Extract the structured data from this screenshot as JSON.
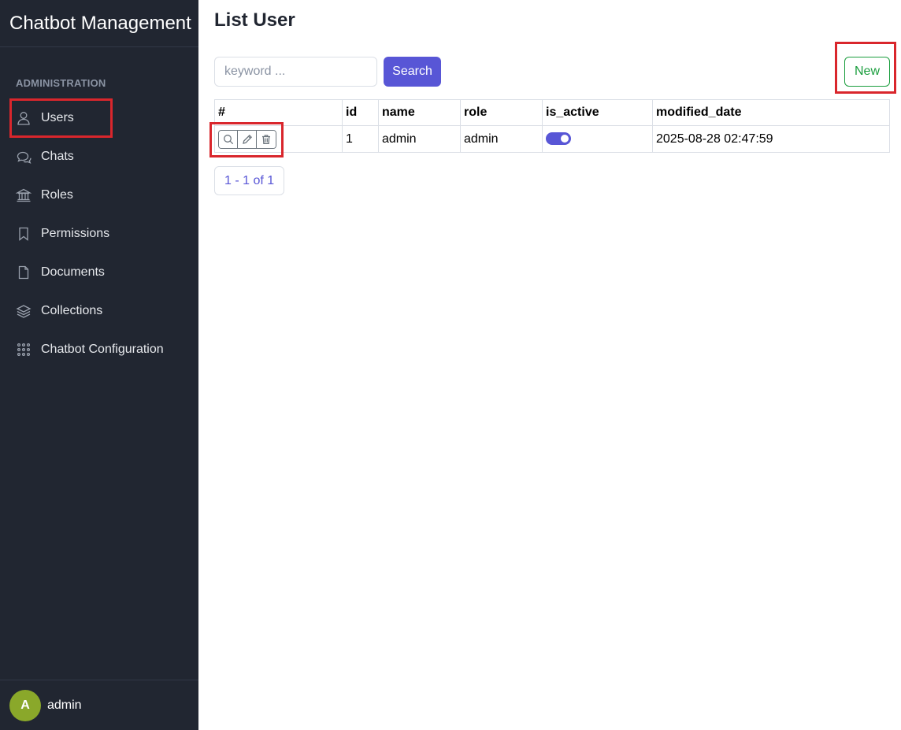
{
  "sidebar": {
    "brand": "Chatbot Management",
    "section_label": "ADMINISTRATION",
    "items": [
      {
        "label": "Users",
        "icon": "user-icon"
      },
      {
        "label": "Chats",
        "icon": "chat-icon"
      },
      {
        "label": "Roles",
        "icon": "bank-icon"
      },
      {
        "label": "Permissions",
        "icon": "bookmark-icon"
      },
      {
        "label": "Documents",
        "icon": "document-icon"
      },
      {
        "label": "Collections",
        "icon": "layers-icon"
      },
      {
        "label": "Chatbot Configuration",
        "icon": "grid-dots-icon"
      }
    ],
    "footer": {
      "avatar_letter": "A",
      "user_name": "admin"
    }
  },
  "main": {
    "title": "List User",
    "search": {
      "placeholder": "keyword ...",
      "value": "",
      "button_label": "Search"
    },
    "new_button_label": "New",
    "table": {
      "headers": [
        "#",
        "id",
        "name",
        "role",
        "is_active",
        "modified_date"
      ],
      "rows": [
        {
          "id": "1",
          "name": "admin",
          "role": "admin",
          "is_active": true,
          "modified_date": "2025-08-28 02:47:59"
        }
      ]
    },
    "pagination": "1 - 1 of 1"
  },
  "colors": {
    "sidebar_bg": "#212631",
    "primary": "#5856d6",
    "success": "#1b9e3e",
    "highlight": "#d9262c",
    "avatar_bg": "#8aa82a"
  }
}
